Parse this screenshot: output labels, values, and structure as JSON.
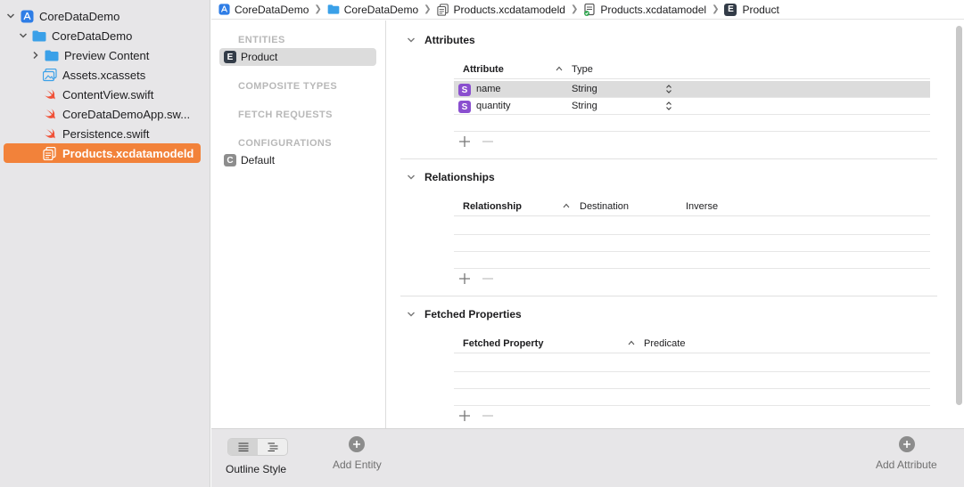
{
  "navigator": {
    "items": [
      {
        "label": "CoreDataDemo",
        "icon": "app-project-icon"
      },
      {
        "label": "CoreDataDemo",
        "icon": "folder-icon"
      },
      {
        "label": "Preview Content",
        "icon": "folder-icon"
      },
      {
        "label": "Assets.xcassets",
        "icon": "asset-catalog-icon"
      },
      {
        "label": "ContentView.swift",
        "icon": "swift-icon"
      },
      {
        "label": "CoreDataDemoApp.sw...",
        "icon": "swift-icon"
      },
      {
        "label": "Persistence.swift",
        "icon": "swift-icon"
      },
      {
        "label": "Products.xcdatamodeld",
        "icon": "data-model-icon"
      }
    ]
  },
  "breadcrumb": [
    "CoreDataDemo",
    "CoreDataDemo",
    "Products.xcdatamodeld",
    "Products.xcdatamodel",
    "Product"
  ],
  "entities_panel": {
    "entities_header": "ENTITIES",
    "entity": {
      "badge": "E",
      "label": "Product"
    },
    "composite_header": "COMPOSITE TYPES",
    "fetch_header": "FETCH REQUESTS",
    "config_header": "CONFIGURATIONS",
    "config": {
      "badge": "C",
      "label": "Default"
    }
  },
  "editor": {
    "attributes": {
      "title": "Attributes",
      "col_attribute": "Attribute",
      "col_type": "Type",
      "rows": [
        {
          "badge": "S",
          "name": "name",
          "type": "String"
        },
        {
          "badge": "S",
          "name": "quantity",
          "type": "String"
        }
      ]
    },
    "relationships": {
      "title": "Relationships",
      "col_relationship": "Relationship",
      "col_destination": "Destination",
      "col_inverse": "Inverse"
    },
    "fetched": {
      "title": "Fetched Properties",
      "col_property": "Fetched Property",
      "col_predicate": "Predicate"
    }
  },
  "bottombar": {
    "outline_style": "Outline Style",
    "add_entity": "Add Entity",
    "add_attribute": "Add Attribute"
  },
  "colors": {
    "selection_orange": "#f2823a",
    "entity_badge": "#333c48",
    "string_badge": "#8a4fcf",
    "folder_blue": "#3aa0e8",
    "swift_orange": "#f05138"
  }
}
